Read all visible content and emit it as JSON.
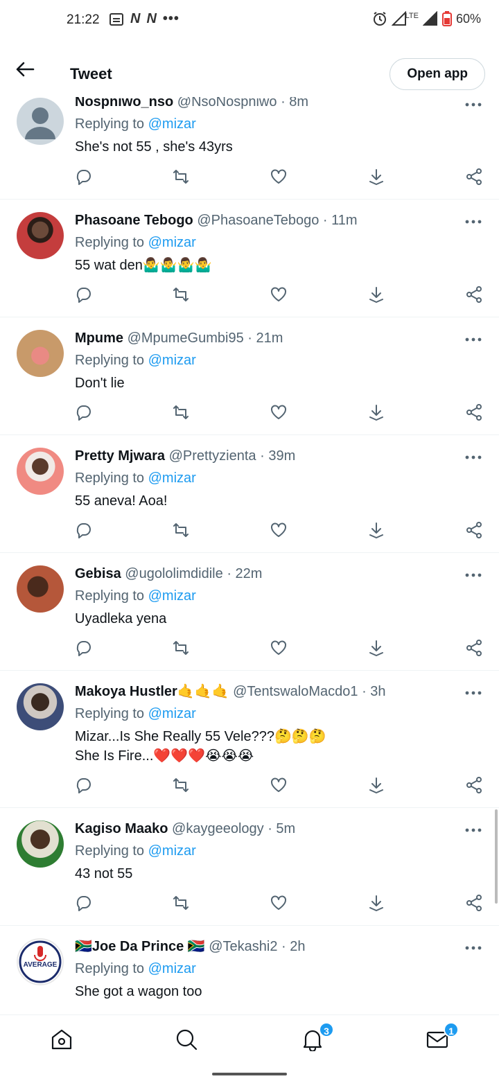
{
  "status_bar": {
    "time": "21:22",
    "notification_icons": [
      "message-icon",
      "netflix-icon",
      "netflix-icon",
      "more-dots-icon"
    ],
    "network": "LTE",
    "battery": "60%"
  },
  "header": {
    "title": "Tweet",
    "open_app_label": "Open app"
  },
  "mention_label": "Replying to",
  "mention": "@mizar",
  "replies": [
    {
      "name": "Nospniwo_nso",
      "handle": "@NsoNospniwo",
      "time": "· 8m",
      "text": "She's not 55 , she's 43yrs",
      "avatar": "default-avatar"
    },
    {
      "name": "Phasoane Tebogo",
      "handle": "@PhasoaneTebogo",
      "time": "· 11m",
      "text": "55 wat den🤷‍♂️🤷‍♂️🤷‍♂️🤷‍♂️",
      "avatar": "photo-avatar"
    },
    {
      "name": "Mpume",
      "handle": "@MpumeGumbi95",
      "time": "· 21m",
      "text": "Don't lie",
      "avatar": "photo-avatar"
    },
    {
      "name": "Pretty Mjwara",
      "handle": "@Prettyzienta",
      "time": "· 39m",
      "text": "55 aneva! Aoa!",
      "avatar": "photo-avatar"
    },
    {
      "name": "Gebisa",
      "handle": "@ugololimdidile",
      "time": "· 22m",
      "text": "Uyadleka yena",
      "avatar": "photo-avatar"
    },
    {
      "name": "Makoya Hustler🤙🤙🤙",
      "handle": "@TentswaloMacdo1",
      "time": "· 3h",
      "text": "Mizar...Is She Really 55 Vele???🤔🤔🤔\nShe Is Fire...❤️❤️❤️😭😭😭",
      "avatar": "photo-avatar"
    },
    {
      "name": "Kagiso Maako",
      "handle": "@kaygeeology",
      "time": "· 5m",
      "text": "43 not 55",
      "avatar": "photo-avatar"
    },
    {
      "name": "🇿🇦Joe Da Prince 🇿🇦",
      "handle": "@Tekashi2",
      "time": "· 2h",
      "text": "She got a wagon too",
      "avatar": "average-logo-avatar",
      "avatar_text": "AVERAGE"
    }
  ],
  "bottom_nav": {
    "notifications_badge": "3",
    "messages_badge": "1"
  },
  "colors": {
    "accent": "#1d9bf0",
    "secondary_text": "#536471",
    "divider": "#eff3f4"
  }
}
